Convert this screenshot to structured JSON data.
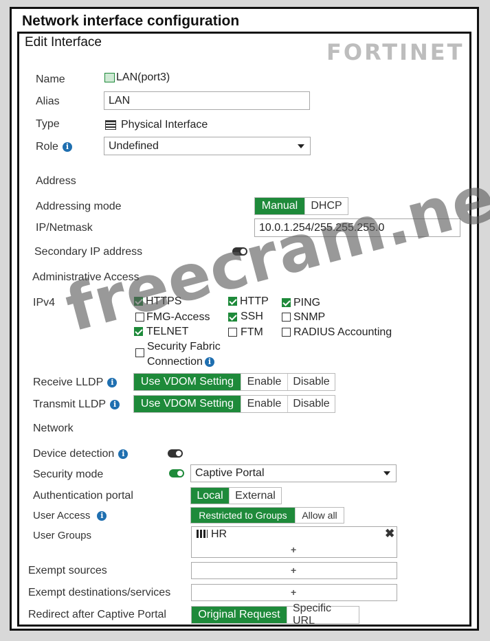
{
  "page": {
    "title": "Network interface configuration"
  },
  "panel": {
    "title": "Edit Interface",
    "brand_logo": "FORTINET"
  },
  "fields": {
    "name_label": "Name",
    "name_value": "LAN(port3)",
    "alias_label": "Alias",
    "alias_value": "LAN",
    "type_label": "Type",
    "type_value": "Physical Interface",
    "role_label": "Role",
    "role_value": "Undefined"
  },
  "address": {
    "section": "Address",
    "mode_label": "Addressing mode",
    "mode_options": [
      "Manual",
      "DHCP"
    ],
    "ip_label": "IP/Netmask",
    "ip_value": "10.0.1.254/255.255.255.0",
    "secondary_label": "Secondary IP address"
  },
  "admin": {
    "section": "Administrative Access",
    "ipv4_label": "IPv4",
    "checkboxes": [
      {
        "label": "HTTPS",
        "checked": true
      },
      {
        "label": "HTTP",
        "checked": true
      },
      {
        "label": "PING",
        "checked": true
      },
      {
        "label": "FMG-Access",
        "checked": false
      },
      {
        "label": "SSH",
        "checked": true
      },
      {
        "label": "SNMP",
        "checked": false
      },
      {
        "label": "TELNET",
        "checked": true
      },
      {
        "label": "FTM",
        "checked": false
      },
      {
        "label": "RADIUS Accounting",
        "checked": false
      }
    ],
    "fabric_line1": "Security Fabric",
    "fabric_line2": "Connection",
    "receive_lldp_label": "Receive LLDP",
    "transmit_lldp_label": "Transmit LLDP",
    "lldp_options": [
      "Use VDOM Setting",
      "Enable",
      "Disable"
    ]
  },
  "network": {
    "section": "Network",
    "device_detection_label": "Device detection",
    "security_mode_label": "Security mode",
    "security_mode_value": "Captive Portal",
    "auth_portal_label": "Authentication portal",
    "auth_portal_options": [
      "Local",
      "External"
    ],
    "user_access_label": "User Access",
    "user_access_options": [
      "Restricted to Groups",
      "Allow all"
    ],
    "user_groups_label": "User Groups",
    "user_group_item": "HR",
    "exempt_sources_label": "Exempt sources",
    "exempt_dest_label": "Exempt destinations/services",
    "redirect_label": "Redirect after Captive Portal",
    "redirect_options": [
      "Original Request",
      "Specific URL"
    ]
  },
  "watermark": "freecram.net",
  "colors": {
    "accent_green": "#1e8a3a",
    "info_blue": "#1f6fb0"
  }
}
